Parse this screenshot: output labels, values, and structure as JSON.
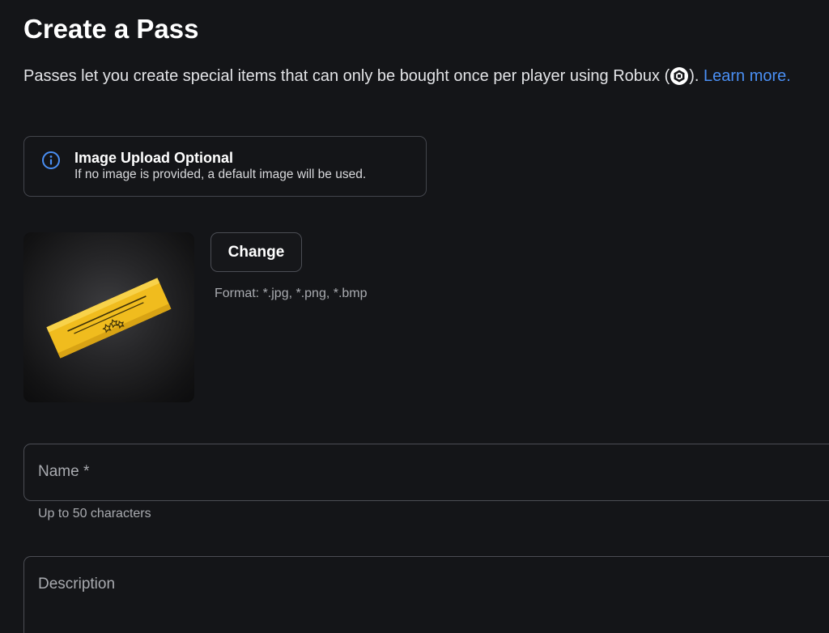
{
  "page": {
    "title": "Create a Pass",
    "description_before": "Passes let you create special items that can only be bought once per player using Robux (",
    "description_after": ").",
    "learn_more": "Learn more.",
    "currency_icon": "robux-icon"
  },
  "info_banner": {
    "icon": "info-icon",
    "title": "Image Upload Optional",
    "text": "If no image is provided, a default image will be used."
  },
  "image_upload": {
    "preview_icon": "pass-ticket-icon",
    "change_label": "Change",
    "format_hint": "Format: *.jpg, *.png, *.bmp"
  },
  "form": {
    "name": {
      "label": "Name *",
      "helper": "Up to 50 characters",
      "value": ""
    },
    "description": {
      "label": "Description",
      "value": ""
    }
  },
  "colors": {
    "background": "#141518",
    "link": "#4a8ff4",
    "border": "#4b4d54",
    "ticket_gold": "#f0bc1e"
  }
}
